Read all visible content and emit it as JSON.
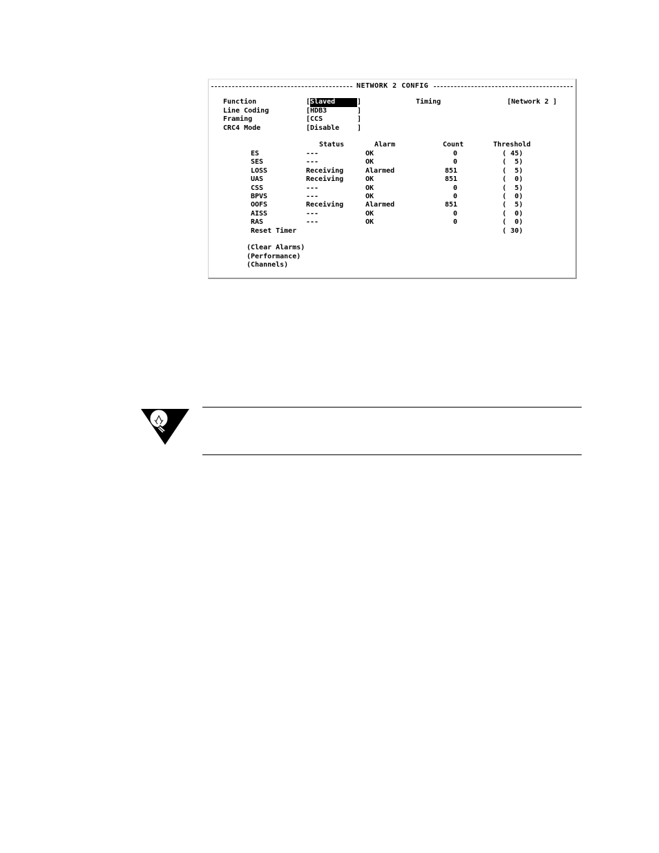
{
  "screen": {
    "title": "NETWORK 2 CONFIG",
    "config_fields": [
      {
        "label": "Function",
        "value": "Slaved",
        "selected": true
      },
      {
        "label": "Line Coding",
        "value": "HDB3"
      },
      {
        "label": "Framing",
        "value": "CCS"
      },
      {
        "label": "CRC4 Mode",
        "value": "Disable"
      }
    ],
    "timing": {
      "label": "Timing",
      "value": "Network 2"
    },
    "table": {
      "headers": {
        "status": "Status",
        "alarm": "Alarm",
        "count": "Count",
        "threshold": "Threshold"
      },
      "rows": [
        {
          "name": "ES",
          "status": "---",
          "alarm": "OK",
          "count": "0",
          "threshold": "( 45)"
        },
        {
          "name": "SES",
          "status": "---",
          "alarm": "OK",
          "count": "0",
          "threshold": "(  5)"
        },
        {
          "name": "LOSS",
          "status": "Receiving",
          "alarm": "Alarmed",
          "count": "851",
          "threshold": "(  5)"
        },
        {
          "name": "UAS",
          "status": "Receiving",
          "alarm": "OK",
          "count": "851",
          "threshold": "(  0)"
        },
        {
          "name": "CSS",
          "status": "---",
          "alarm": "OK",
          "count": "0",
          "threshold": "(  5)"
        },
        {
          "name": "BPVS",
          "status": "---",
          "alarm": "OK",
          "count": "0",
          "threshold": "(  0)"
        },
        {
          "name": "OOFS",
          "status": "Receiving",
          "alarm": "Alarmed",
          "count": "851",
          "threshold": "(  5)"
        },
        {
          "name": "AISS",
          "status": "---",
          "alarm": "OK",
          "count": "0",
          "threshold": "(  0)"
        },
        {
          "name": "RAS",
          "status": "---",
          "alarm": "OK",
          "count": "0",
          "threshold": "(  0)"
        }
      ],
      "reset_timer": {
        "label": "Reset Timer",
        "value": "( 30)"
      }
    },
    "actions": [
      "(Clear Alarms)",
      "(Performance)",
      "(Channels)"
    ]
  },
  "icons": {
    "tip": "lightbulb-icon"
  }
}
